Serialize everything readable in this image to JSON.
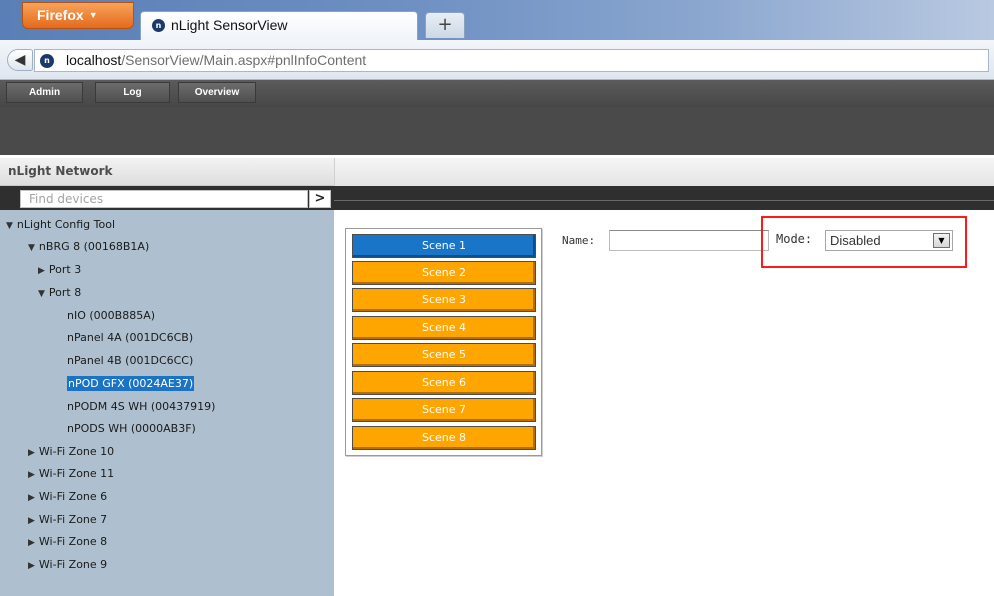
{
  "browser": {
    "menu_label": "Firefox",
    "tab_title": "nLight SensorView",
    "new_tab_label": "+",
    "url_host": "localhost",
    "url_path": "/SensorView/Main.aspx#pnlInfoContent"
  },
  "app_nav": {
    "tabs": [
      "Admin",
      "Log",
      "Overview"
    ]
  },
  "left_panel": {
    "title": "nLight Network",
    "search_placeholder": "Find devices",
    "search_button": ">"
  },
  "tree": {
    "root": "nLight Config Tool",
    "bridge": "nBRG 8 (00168B1A)",
    "port3": "Port 3",
    "port8": "Port 8",
    "devices": [
      "nIO (000B885A)",
      "nPanel 4A (001DC6CB)",
      "nPanel 4B (001DC6CC)",
      "nPOD GFX (0024AE37)",
      "nPODM 4S WH (00437919)",
      "nPODS WH (0000AB3F)"
    ],
    "selected_device": "nPOD GFX (0024AE37)",
    "zones": [
      "Wi-Fi Zone 10",
      "Wi-Fi Zone 11",
      "Wi-Fi Zone 6",
      "Wi-Fi Zone 7",
      "Wi-Fi Zone 8",
      "Wi-Fi Zone 9"
    ]
  },
  "scenes": {
    "items": [
      "Scene 1",
      "Scene 2",
      "Scene 3",
      "Scene 4",
      "Scene 5",
      "Scene 6",
      "Scene 7",
      "Scene 8"
    ],
    "active": "Scene 1"
  },
  "form": {
    "name_label": "Name:",
    "name_value": "",
    "mode_label": "Mode:",
    "mode_value": "Disabled"
  },
  "colors": {
    "scene_inactive": "#ffa500",
    "scene_active": "#1875c8",
    "highlight_box": "#ff1a1a",
    "tree_background": "#aec0cf"
  }
}
